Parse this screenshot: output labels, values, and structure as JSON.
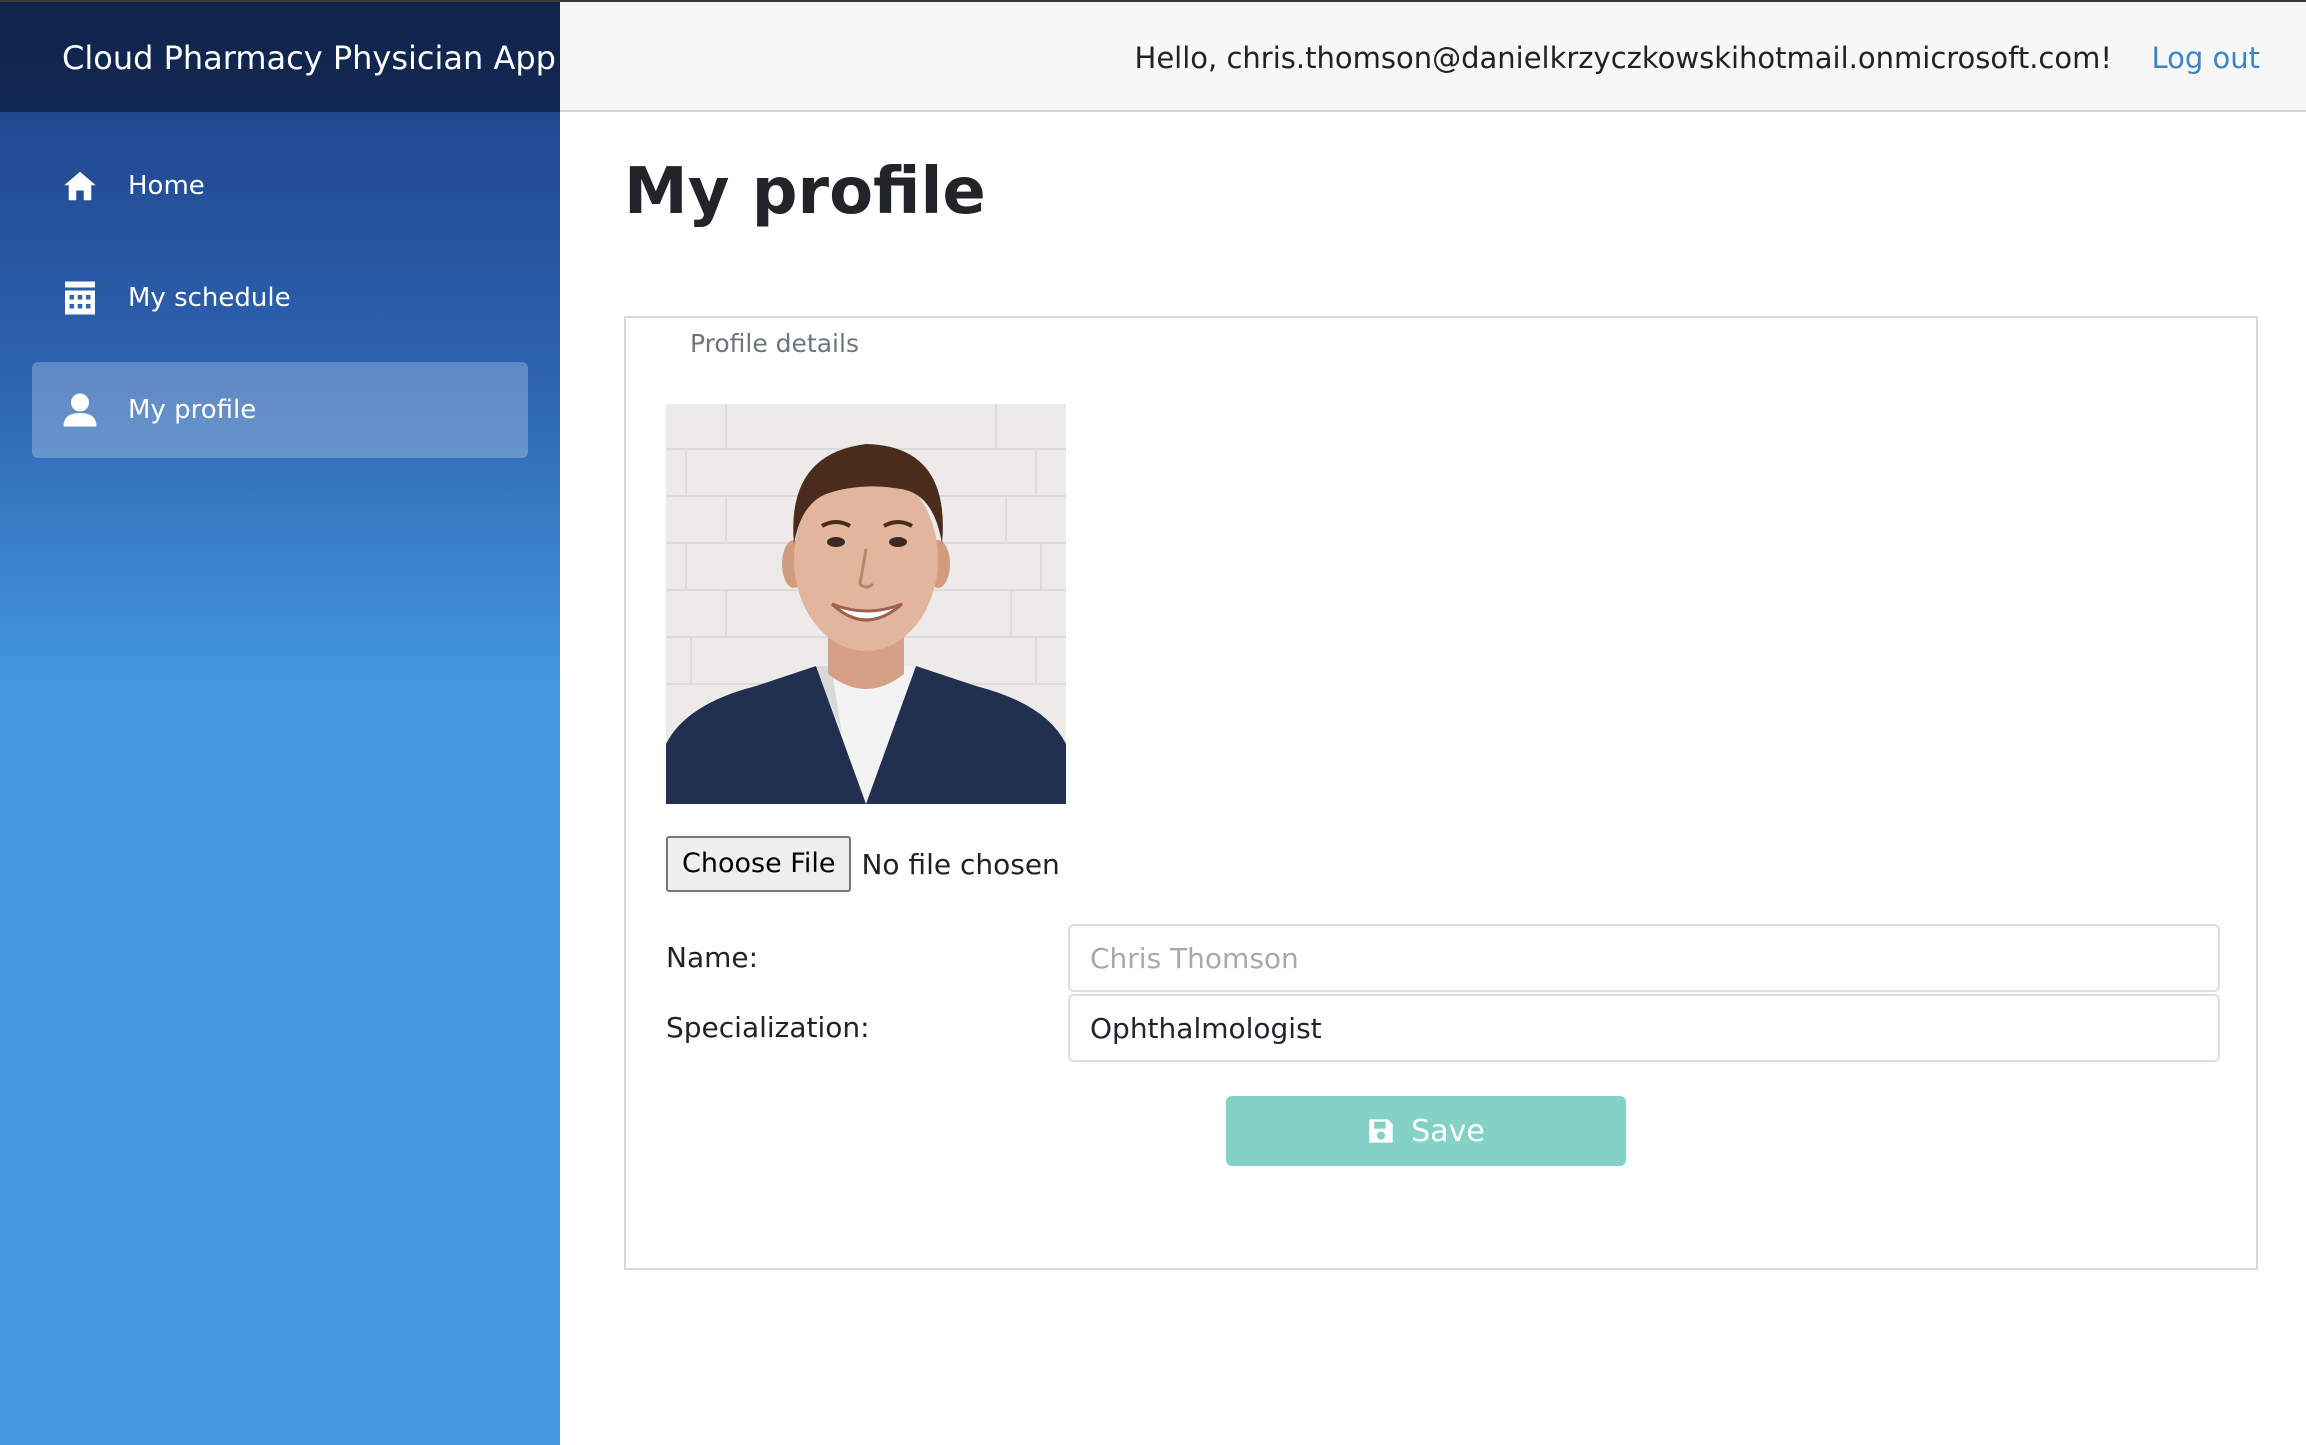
{
  "app": {
    "title": "Cloud Pharmacy Physician App"
  },
  "header": {
    "greeting": "Hello, chris.thomson@danielkrzyczkowskihotmail.onmicrosoft.com!",
    "logout_label": "Log out",
    "logout_color": "#3d85c6"
  },
  "sidebar": {
    "items": [
      {
        "label": "Home",
        "icon": "home-icon",
        "active": false
      },
      {
        "label": "My schedule",
        "icon": "calendar-icon",
        "active": false
      },
      {
        "label": "My profile",
        "icon": "user-icon",
        "active": true
      }
    ]
  },
  "main": {
    "page_title": "My profile",
    "profile_details": {
      "legend": "Profile details",
      "file_input": {
        "button_label": "Choose File",
        "status": "No file chosen"
      },
      "name": {
        "label": "Name:",
        "value": "Chris Thomson"
      },
      "specialization": {
        "label": "Specialization:",
        "value": "Ophthalmologist"
      },
      "save_label": "Save",
      "save_color": "#84d1c6"
    }
  }
}
